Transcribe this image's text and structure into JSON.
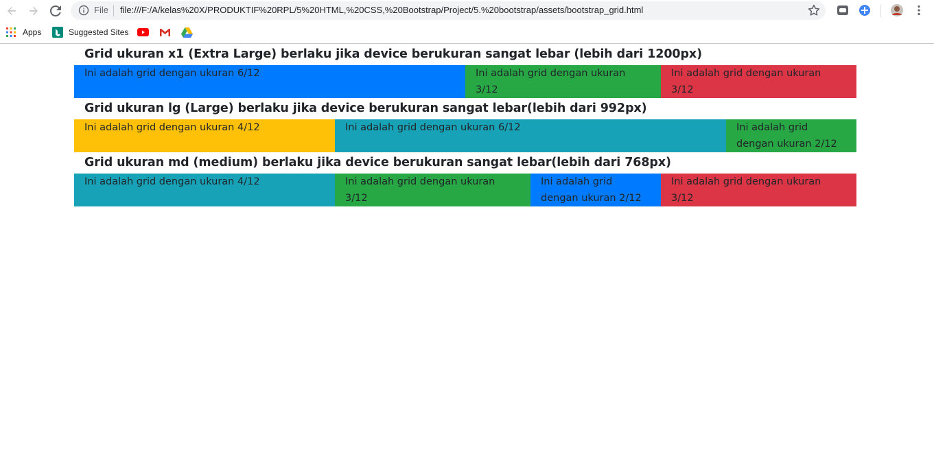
{
  "browser": {
    "omnibox": {
      "scheme_label": "File",
      "url": "file:///F:/A/kelas%20X/PRODUKTIF%20RPL/5%20HTML,%20CSS,%20Bootstrap/Project/5.%20bootstrap/assets/bootstrap_grid.html"
    },
    "bookmarks": {
      "apps_label": "Apps",
      "suggested_label": "Suggested Sites"
    }
  },
  "sections": [
    {
      "heading": "Grid ukuran x1 (Extra Large) berlaku jika device berukuran sangat lebar (lebih dari 1200px)",
      "columns": [
        {
          "text": "Ini adalah grid dengan ukuran 6/12",
          "color": "#007bff"
        },
        {
          "text": "Ini adalah grid dengan ukuran 3/12",
          "color": "#28a745"
        },
        {
          "text": "Ini adalah grid dengan ukuran 3/12",
          "color": "#dc3545"
        }
      ]
    },
    {
      "heading": "Grid ukuran lg (Large) berlaku jika device berukuran sangat lebar(lebih dari 992px)",
      "columns": [
        {
          "text": "Ini adalah grid dengan ukuran 4/12",
          "color": "#ffc107"
        },
        {
          "text": "Ini adalah grid dengan ukuran 6/12",
          "color": "#17a2b8"
        },
        {
          "text": "Ini adalah grid dengan ukuran 2/12",
          "color": "#28a745"
        }
      ]
    },
    {
      "heading": "Grid ukuran md (medium) berlaku jika device berukuran sangat lebar(lebih dari 768px)",
      "columns": [
        {
          "text": "Ini adalah grid dengan ukuran 4/12",
          "color": "#17a2b8"
        },
        {
          "text": "Ini adalah grid dengan ukuran 3/12",
          "color": "#28a745"
        },
        {
          "text": "Ini adalah grid dengan ukuran 2/12",
          "color": "#007bff"
        },
        {
          "text": "Ini adalah grid dengan ukuran 3/12",
          "color": "#dc3545"
        }
      ]
    }
  ]
}
